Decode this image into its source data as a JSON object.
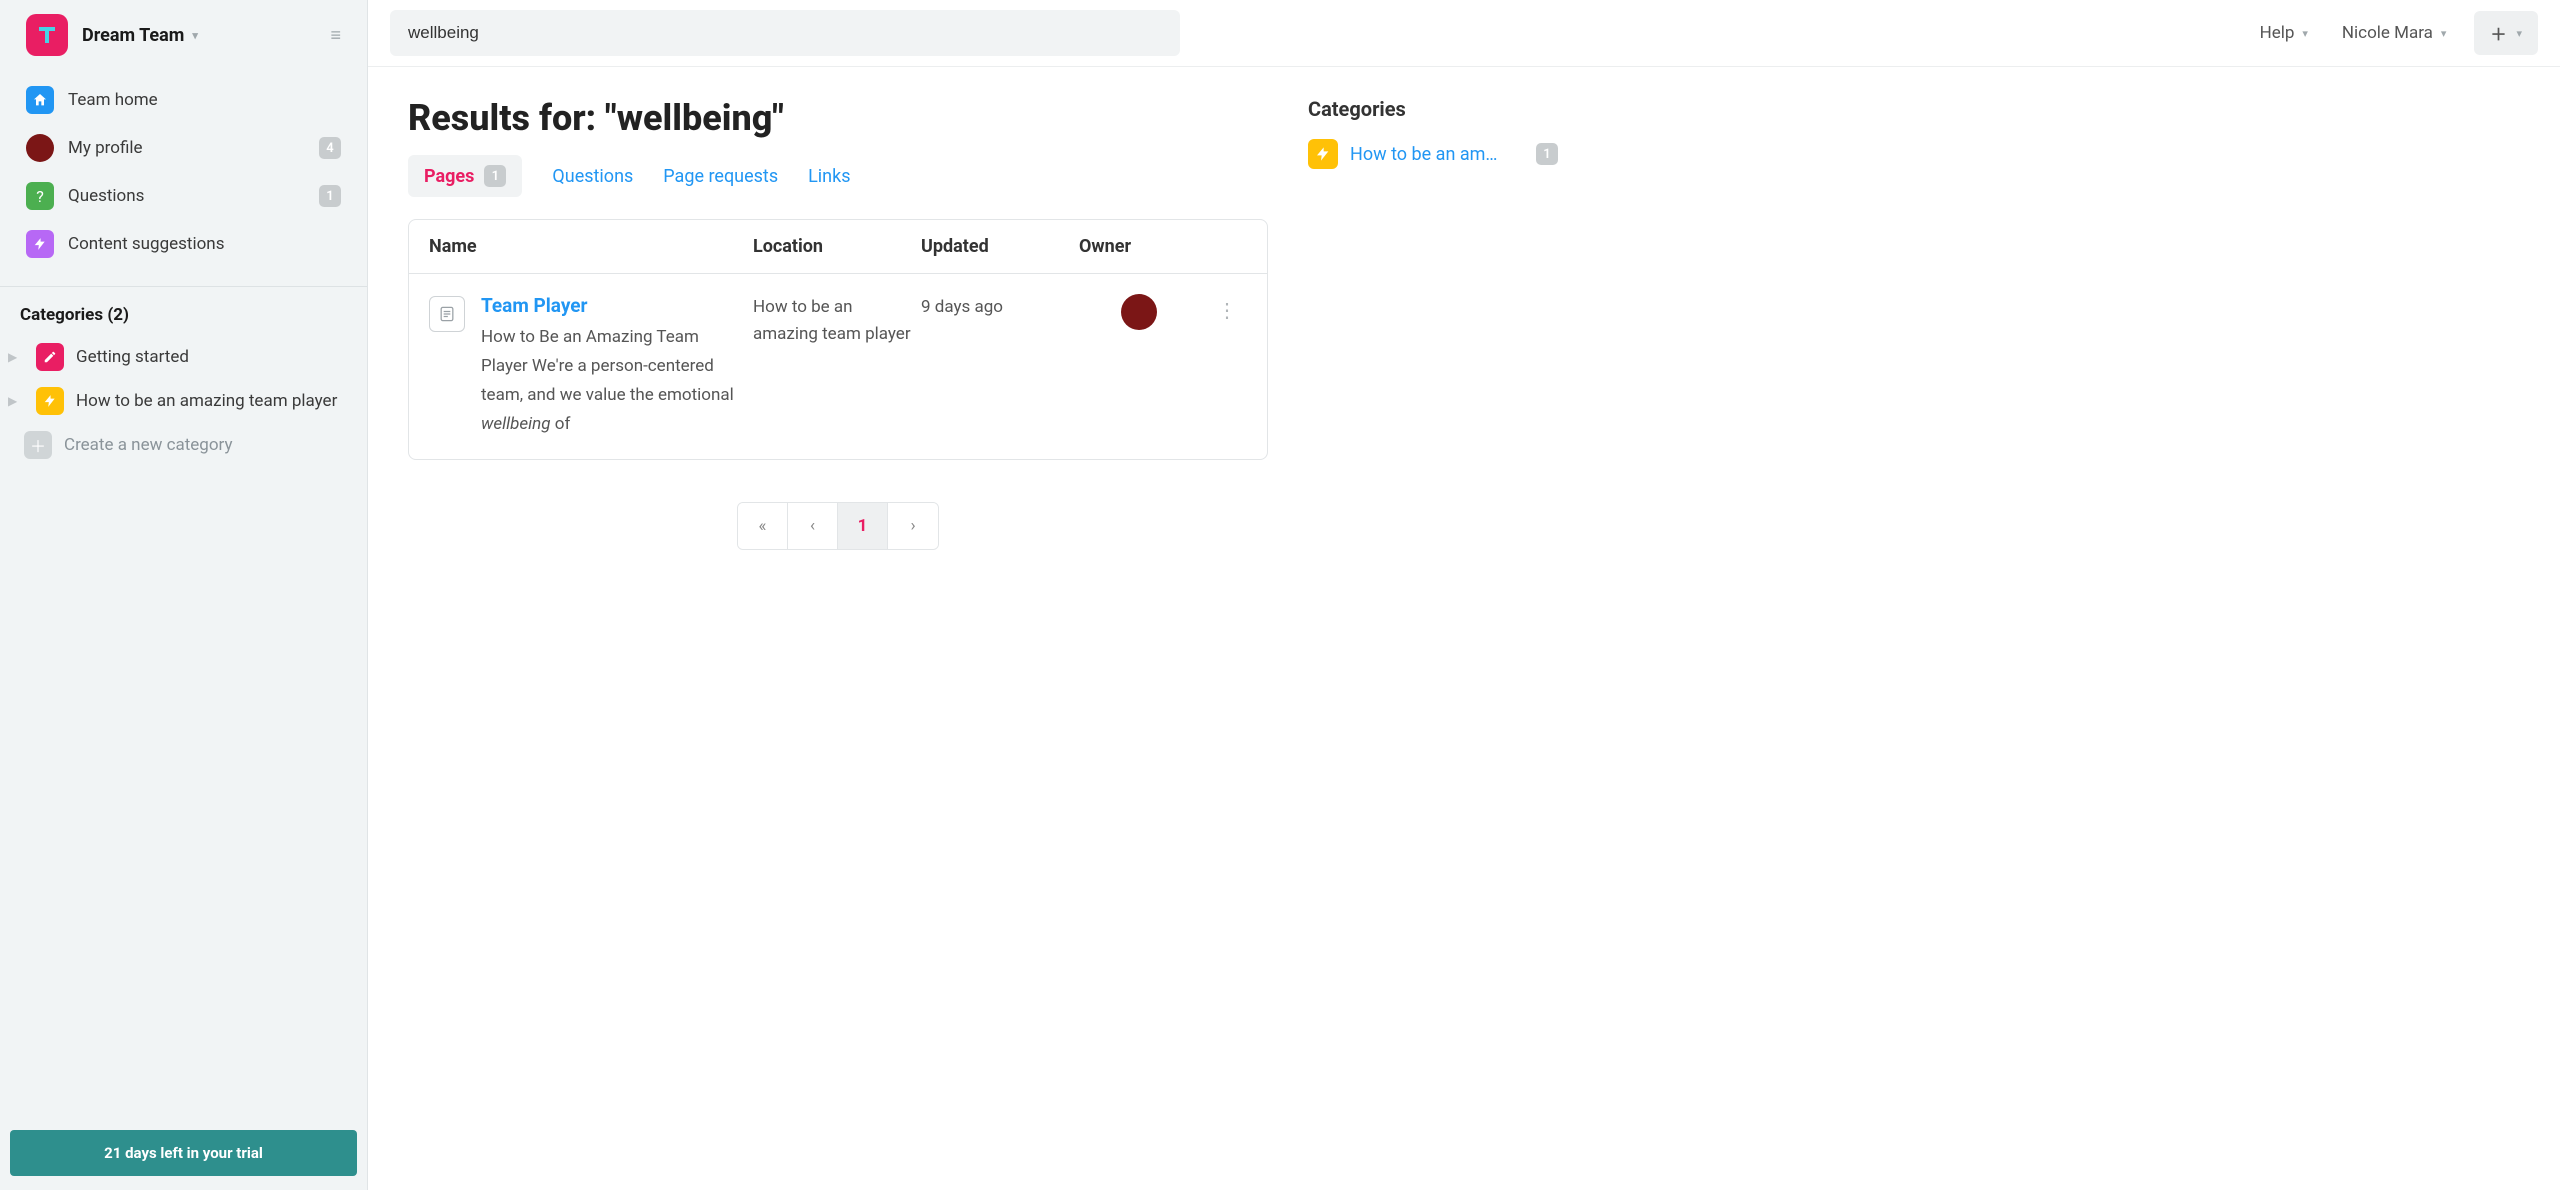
{
  "team": {
    "name": "Dream Team"
  },
  "search": {
    "value": "wellbeing"
  },
  "header": {
    "help_label": "Help",
    "user_name": "Nicole Mara"
  },
  "sidebar": {
    "items": [
      {
        "label": "Team home"
      },
      {
        "label": "My profile",
        "badge": "4"
      },
      {
        "label": "Questions",
        "badge": "1"
      },
      {
        "label": "Content suggestions"
      }
    ],
    "categories_header": "Categories (2)",
    "categories": [
      {
        "label": "Getting started"
      },
      {
        "label": "How to be an amazing team player"
      }
    ],
    "create_category_label": "Create a new category",
    "trial_text": "21 days left in your trial"
  },
  "results": {
    "title": "Results for: \"wellbeing\"",
    "tabs": {
      "pages": "Pages",
      "pages_count": "1",
      "questions": "Questions",
      "page_requests": "Page requests",
      "links": "Links"
    },
    "columns": {
      "name": "Name",
      "location": "Location",
      "updated": "Updated",
      "owner": "Owner"
    },
    "rows": [
      {
        "title": "Team Player",
        "snippet_pre": "How to Be an Amazing Team Player We're a person-centered team, and we value the emotional ",
        "snippet_match": "wellbeing",
        "snippet_post": " of",
        "location": "How to be an amazing team player",
        "updated": "9 days ago"
      }
    ],
    "pagination": {
      "first": "«",
      "prev": "‹",
      "current": "1",
      "next": "›"
    }
  },
  "side_categories": {
    "title": "Categories",
    "items": [
      {
        "label": "How to be an am…",
        "count": "1"
      }
    ]
  }
}
